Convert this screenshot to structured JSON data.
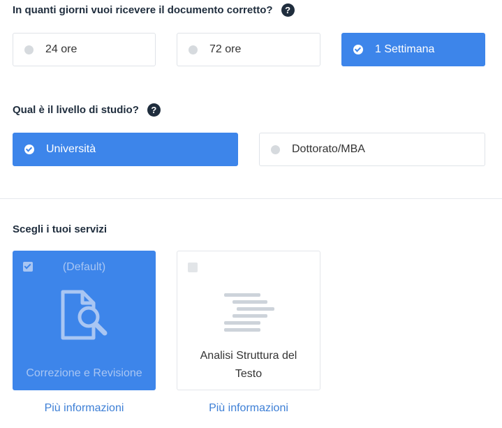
{
  "delivery": {
    "question": "In quanti giorni vuoi ricevere il documento corretto?",
    "options": [
      {
        "label": "24 ore",
        "selected": false
      },
      {
        "label": "72 ore",
        "selected": false
      },
      {
        "label": "1 Settimana",
        "selected": true
      }
    ]
  },
  "level": {
    "question": "Qual è il livello di studio?",
    "options": [
      {
        "label": "Università",
        "selected": true
      },
      {
        "label": "Dottorato/MBA",
        "selected": false
      }
    ]
  },
  "services": {
    "title": "Scegli i tuoi servizi",
    "cards": [
      {
        "tag": "(Default)",
        "name": "Correzione e Revisione",
        "checked": true,
        "icon": "document-search-icon",
        "link": "Più informazioni"
      },
      {
        "name": "Analisi Struttura del Testo",
        "checked": false,
        "icon": "text-lines-icon",
        "link": "Più informazioni"
      }
    ]
  },
  "help_icon": "?",
  "colors": {
    "accent": "#3d85ea",
    "link": "#3d7fd6",
    "text": "#1f2d3d"
  }
}
